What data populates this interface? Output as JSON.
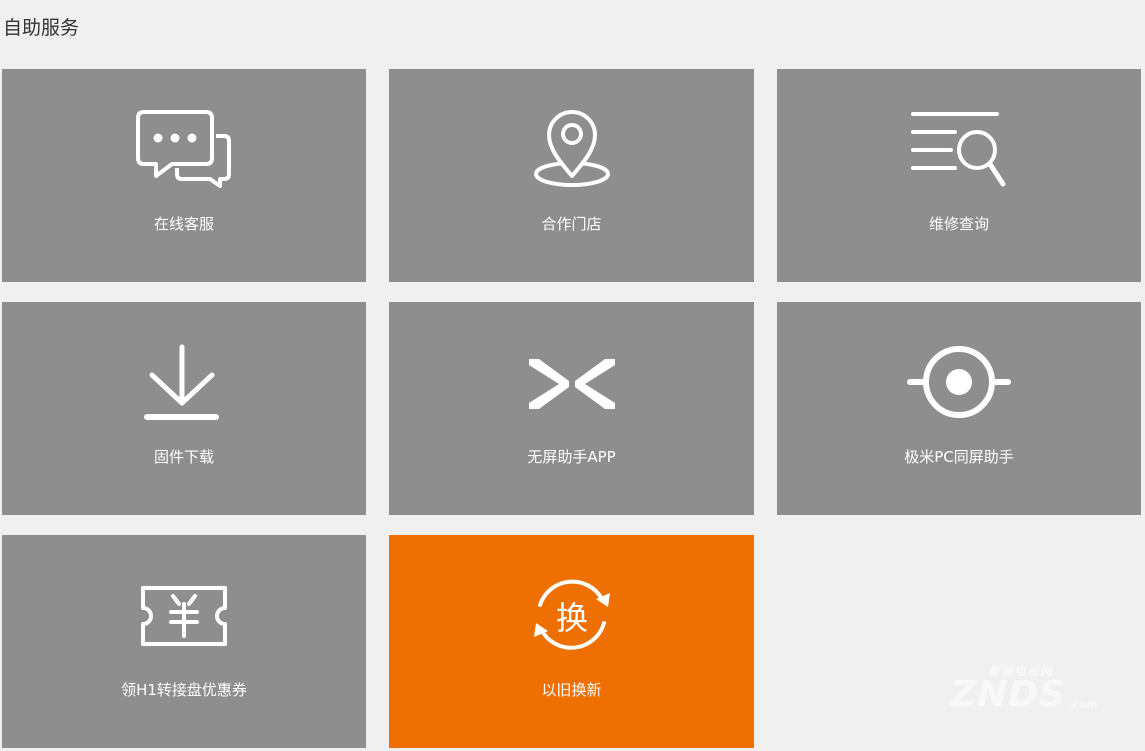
{
  "section": {
    "title": "自助服务"
  },
  "tiles": [
    {
      "label": "在线客服",
      "icon": "chat-bubbles-icon"
    },
    {
      "label": "合作门店",
      "icon": "map-pin-icon"
    },
    {
      "label": "维修查询",
      "icon": "search-list-icon"
    },
    {
      "label": "固件下载",
      "icon": "download-icon"
    },
    {
      "label": "无屏助手APP",
      "icon": "cast-arrows-icon"
    },
    {
      "label": "极米PC同屏助手",
      "icon": "target-icon"
    },
    {
      "label": "领H1转接盘优惠券",
      "icon": "coupon-icon"
    },
    {
      "label": "以旧换新",
      "icon": "trade-in-icon",
      "icon_text": "换"
    }
  ],
  "colors": {
    "tile": "#8e8e8e",
    "highlight": "#ee6f02",
    "background": "#f0f0f0"
  },
  "watermark": {
    "top_text": "智能电视网",
    "main_text": "ZNDS",
    "suffix": ".com"
  }
}
